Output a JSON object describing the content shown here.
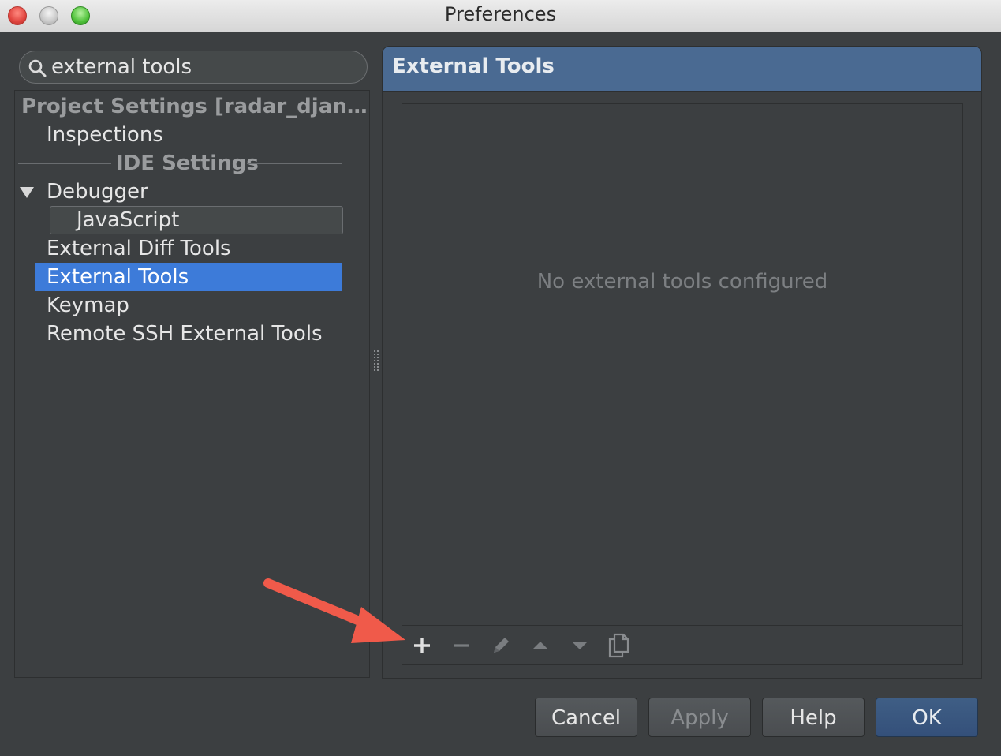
{
  "window": {
    "title": "Preferences"
  },
  "search": {
    "value": "external tools",
    "placeholder": ""
  },
  "tree": {
    "project_group": "Project Settings [radar_djan…",
    "inspections": "Inspections",
    "ide_group": "IDE Settings",
    "debugger": "Debugger",
    "javascript": "JavaScript",
    "external_diff_tools": "External Diff Tools",
    "external_tools": "External Tools",
    "keymap": "Keymap",
    "remote_ssh": "Remote SSH External Tools"
  },
  "panel": {
    "title": "External Tools",
    "empty_message": "No external tools configured"
  },
  "toolbar_icons": [
    "add-icon",
    "remove-icon",
    "edit-icon",
    "move-up-icon",
    "move-down-icon",
    "copy-icon"
  ],
  "buttons": {
    "cancel": "Cancel",
    "apply": "Apply",
    "help": "Help",
    "ok": "OK"
  },
  "colors": {
    "selection": "#3d7bd9",
    "header": "#4a6a92",
    "annotation_arrow": "#f05a4a"
  }
}
